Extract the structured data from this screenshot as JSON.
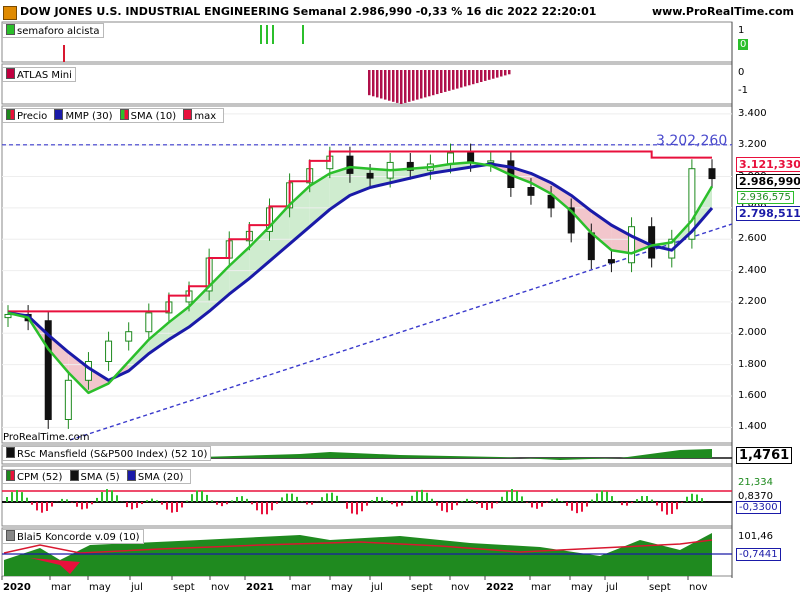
{
  "header": {
    "title": "DOW JONES U.S. INDUSTRIAL ENGINEERING Semanal 2.986,990 -0,33 % 16 dic 2022 22:20:01",
    "site": "www.ProRealTime.com"
  },
  "panels": {
    "semaforo": {
      "label": "semaforo alcista",
      "axis": [
        "1",
        "0"
      ]
    },
    "atlas": {
      "label": "ATLAS Mini",
      "axis": [
        "0",
        "-1"
      ]
    },
    "price": {
      "legend": [
        "Precio",
        "MMP (30)",
        "SMA (10)",
        "max"
      ],
      "axis": [
        "3.400",
        "3.200",
        "3.000",
        "2.800",
        "2.600",
        "2.400",
        "2.200",
        "2.000",
        "1.800",
        "1.600",
        "1.400"
      ],
      "level_label": "3.202,260",
      "last_labels": {
        "max": "3.121,330",
        "price": "2.986,990",
        "sma10": "2.936,575",
        "mmp30": "2.798,511"
      },
      "watermark": "ProRealTime.com"
    },
    "rsc": {
      "label": "RSc Mansfield (S&P500 Index) (52 10)",
      "value": "1,4761"
    },
    "cpm": {
      "legend": [
        "CPM (52)",
        "SMA (5)",
        "SMA (20)"
      ],
      "values": [
        "21,334",
        "0,8370",
        "-0,3300"
      ]
    },
    "koncorde": {
      "label": "Blai5 Koncorde v.09 (10)",
      "values": [
        "101,46",
        "-0,7441"
      ]
    }
  },
  "xaxis": [
    "2020",
    "mar",
    "may",
    "jul",
    "sept",
    "nov",
    "2021",
    "mar",
    "may",
    "jul",
    "sept",
    "nov",
    "2022",
    "mar",
    "may",
    "jul",
    "sept",
    "nov"
  ],
  "colors": {
    "candle_up": "#1e8a1e",
    "candle_down": "#111111",
    "mmp": "#1a1aa8",
    "sma": "#2bbf2b",
    "max": "#e8103c",
    "trend": "#3a3acc",
    "koncorde_green": "#1f8a1f"
  },
  "chart_data": {
    "type": "line",
    "title": "DOW JONES U.S. INDUSTRIAL ENGINEERING",
    "x": [
      "2020-01",
      "2020-02",
      "2020-03",
      "2020-04",
      "2020-05",
      "2020-06",
      "2020-07",
      "2020-08",
      "2020-09",
      "2020-10",
      "2020-11",
      "2020-12",
      "2021-01",
      "2021-02",
      "2021-03",
      "2021-04",
      "2021-05",
      "2021-06",
      "2021-07",
      "2021-08",
      "2021-09",
      "2021-10",
      "2021-11",
      "2021-12",
      "2022-01",
      "2022-02",
      "2022-03",
      "2022-04",
      "2022-05",
      "2022-06",
      "2022-07",
      "2022-08",
      "2022-09",
      "2022-10",
      "2022-11",
      "2022-12"
    ],
    "series": [
      {
        "name": "Precio",
        "values": [
          2120,
          2080,
          1450,
          1700,
          1820,
          1950,
          2010,
          2130,
          2200,
          2270,
          2480,
          2590,
          2650,
          2800,
          2960,
          3050,
          3130,
          3020,
          2990,
          3090,
          3040,
          3080,
          3150,
          3090,
          3100,
          2930,
          2880,
          2800,
          2640,
          2470,
          2450,
          2680,
          2480,
          2600,
          3050,
          2987
        ]
      },
      {
        "name": "MMP (30)",
        "values": [
          2130,
          2110,
          1990,
          1880,
          1780,
          1700,
          1760,
          1870,
          1960,
          2040,
          2140,
          2250,
          2350,
          2460,
          2570,
          2680,
          2790,
          2880,
          2930,
          2960,
          2990,
          3020,
          3040,
          3060,
          3080,
          3060,
          3020,
          2960,
          2880,
          2780,
          2690,
          2620,
          2560,
          2530,
          2650,
          2799
        ]
      },
      {
        "name": "SMA (10)",
        "values": [
          2130,
          2100,
          1900,
          1750,
          1620,
          1680,
          1820,
          1960,
          2070,
          2170,
          2300,
          2430,
          2550,
          2680,
          2820,
          2940,
          3020,
          3060,
          3050,
          3040,
          3050,
          3060,
          3080,
          3090,
          3070,
          3010,
          2960,
          2890,
          2780,
          2640,
          2530,
          2510,
          2560,
          2580,
          2720,
          2937
        ]
      },
      {
        "name": "max",
        "values": [
          2140,
          2140,
          2140,
          2140,
          2140,
          2140,
          2140,
          2140,
          2240,
          2300,
          2480,
          2600,
          2690,
          2810,
          2970,
          3100,
          3160,
          3160,
          3160,
          3160,
          3160,
          3160,
          3160,
          3160,
          3160,
          3160,
          3160,
          3160,
          3160,
          3160,
          3160,
          3160,
          3121,
          3121,
          3121,
          3121
        ]
      }
    ],
    "ylim": [
      1300,
      3450
    ],
    "xlabel": "",
    "ylabel": ""
  }
}
